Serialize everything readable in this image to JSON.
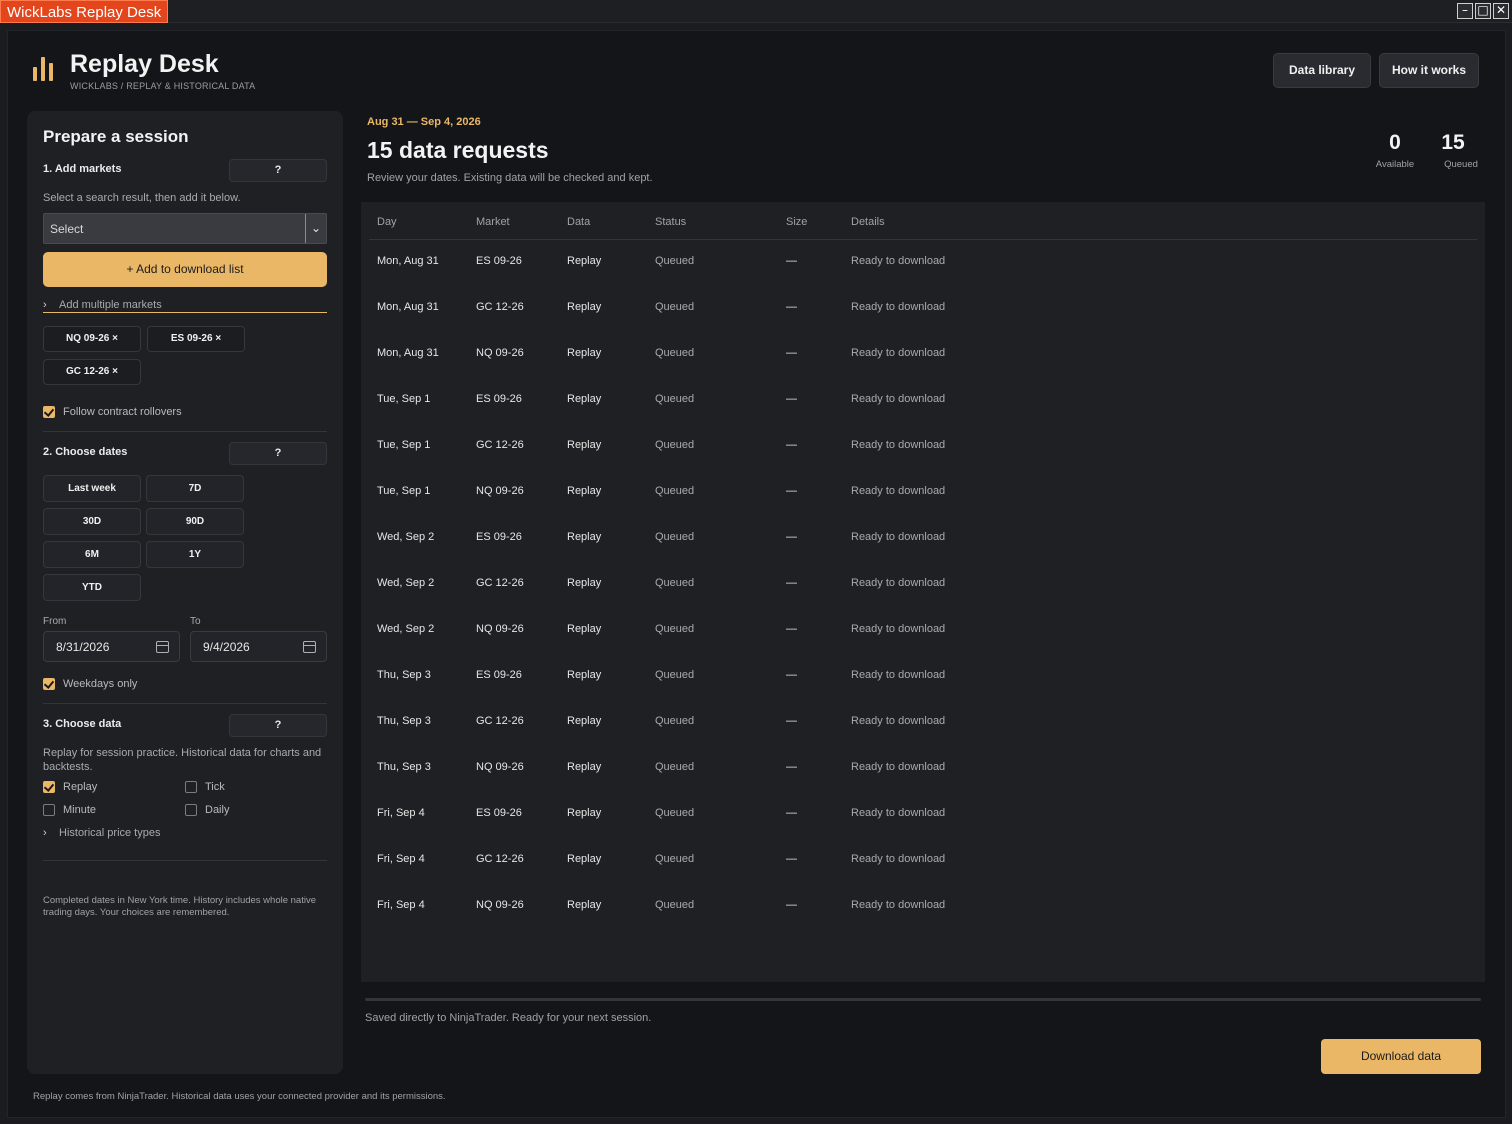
{
  "window": {
    "title": "WickLabs Replay Desk",
    "controls": [
      "minimize",
      "maximize",
      "close"
    ]
  },
  "header": {
    "title": "Replay Desk",
    "breadcrumb": "WICKLABS  /  REPLAY & HISTORICAL DATA",
    "buttons": {
      "library": "Data library",
      "how": "How it works"
    }
  },
  "sidebar": {
    "title": "Prepare a session",
    "help": "?",
    "markets": {
      "label": "1. Add markets",
      "hint": "Select a search result, then add it below.",
      "select_value": "Select",
      "add_button": "+  Add to download list",
      "multiple": "Add multiple markets",
      "chips": [
        "NQ 09-26  ×",
        "ES 09-26  ×",
        "GC 12-26  ×"
      ],
      "rollovers": "Follow contract rollovers",
      "rollovers_checked": true
    },
    "dates": {
      "label": "2. Choose dates",
      "presets": [
        "Last week",
        "7D",
        "30D",
        "90D",
        "6M",
        "1Y",
        "YTD"
      ],
      "from_label": "From",
      "to_label": "To",
      "from": "8/31/2026",
      "to": "9/4/2026",
      "weekdays": "Weekdays only",
      "weekdays_checked": true
    },
    "data": {
      "label": "3. Choose data",
      "hint": "Replay for session practice. Historical data for charts and backtests.",
      "options": [
        {
          "label": "Replay",
          "checked": true
        },
        {
          "label": "Tick",
          "checked": false
        },
        {
          "label": "Minute",
          "checked": false
        },
        {
          "label": "Daily",
          "checked": false
        }
      ],
      "price_types": "Historical price types"
    },
    "note": "Completed dates in New York time. History includes whole native trading days. Your choices are remembered."
  },
  "main": {
    "range": "Aug 31 — Sep 4, 2026",
    "title": "15 data requests",
    "subtitle": "Review your dates. Existing data will be checked and kept.",
    "stats": {
      "available": "0",
      "available_label": "Available",
      "queued": "15",
      "queued_label": "Queued"
    },
    "columns": [
      "Day",
      "Market",
      "Data",
      "Status",
      "Size",
      "Details"
    ],
    "rows": [
      [
        "Mon, Aug 31",
        "ES 09-26",
        "Replay",
        "Queued",
        "—",
        "Ready to download"
      ],
      [
        "Mon, Aug 31",
        "GC 12-26",
        "Replay",
        "Queued",
        "—",
        "Ready to download"
      ],
      [
        "Mon, Aug 31",
        "NQ 09-26",
        "Replay",
        "Queued",
        "—",
        "Ready to download"
      ],
      [
        "Tue, Sep 1",
        "ES 09-26",
        "Replay",
        "Queued",
        "—",
        "Ready to download"
      ],
      [
        "Tue, Sep 1",
        "GC 12-26",
        "Replay",
        "Queued",
        "—",
        "Ready to download"
      ],
      [
        "Tue, Sep 1",
        "NQ 09-26",
        "Replay",
        "Queued",
        "—",
        "Ready to download"
      ],
      [
        "Wed, Sep 2",
        "ES 09-26",
        "Replay",
        "Queued",
        "—",
        "Ready to download"
      ],
      [
        "Wed, Sep 2",
        "GC 12-26",
        "Replay",
        "Queued",
        "—",
        "Ready to download"
      ],
      [
        "Wed, Sep 2",
        "NQ 09-26",
        "Replay",
        "Queued",
        "—",
        "Ready to download"
      ],
      [
        "Thu, Sep 3",
        "ES 09-26",
        "Replay",
        "Queued",
        "—",
        "Ready to download"
      ],
      [
        "Thu, Sep 3",
        "GC 12-26",
        "Replay",
        "Queued",
        "—",
        "Ready to download"
      ],
      [
        "Thu, Sep 3",
        "NQ 09-26",
        "Replay",
        "Queued",
        "—",
        "Ready to download"
      ],
      [
        "Fri, Sep 4",
        "ES 09-26",
        "Replay",
        "Queued",
        "—",
        "Ready to download"
      ],
      [
        "Fri, Sep 4",
        "GC 12-26",
        "Replay",
        "Queued",
        "—",
        "Ready to download"
      ],
      [
        "Fri, Sep 4",
        "NQ 09-26",
        "Replay",
        "Queued",
        "—",
        "Ready to download"
      ]
    ],
    "progress": 0,
    "saved": "Saved directly to NinjaTrader. Ready for your next session.",
    "download": "Download data"
  },
  "footer": "Replay comes from NinjaTrader. Historical data uses your connected provider and its permissions.",
  "colors": {
    "accent": "#e9b766",
    "title_tag": "#e3461c",
    "panel": "#1f2024",
    "background": "#141518"
  }
}
